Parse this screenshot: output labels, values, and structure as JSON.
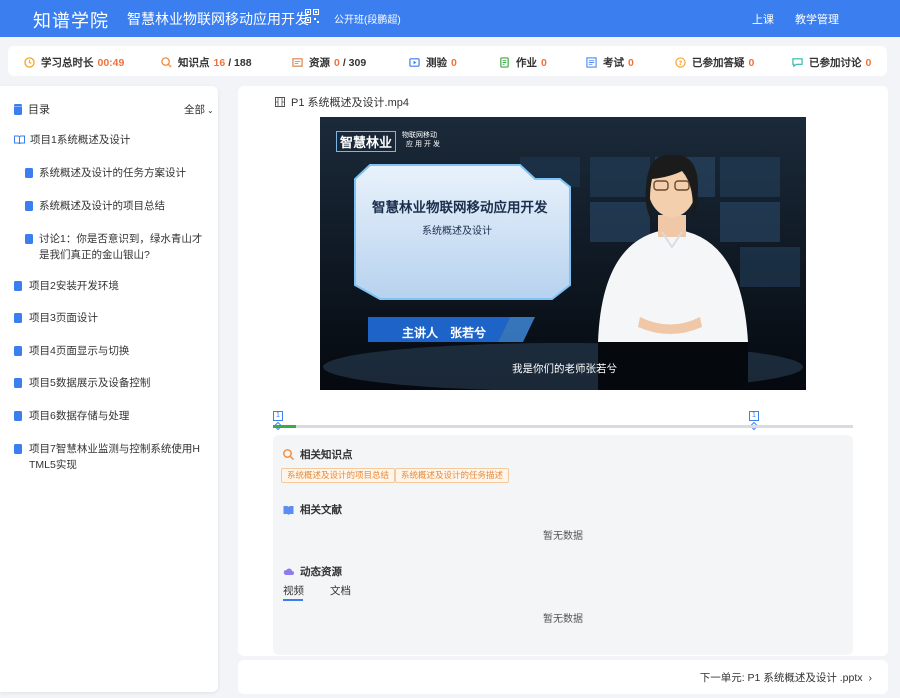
{
  "header": {
    "logo": "知谱学院",
    "course_title": "智慧林业物联网移动应用开发",
    "class_name": "公开班(段鹏超)",
    "nav": {
      "class": "上课",
      "manage": "教学管理"
    },
    "brand_color": "#3a7ef0"
  },
  "stats": [
    {
      "label": "学习总时长",
      "value": "00:49",
      "total": "",
      "icon": "clock-icon"
    },
    {
      "label": "知识点",
      "value": "16",
      "total": "/ 188",
      "icon": "knowledge-icon"
    },
    {
      "label": "资源",
      "value": "0",
      "total": "/ 309",
      "icon": "resource-icon"
    },
    {
      "label": "测验",
      "value": "0",
      "total": "",
      "icon": "quiz-icon"
    },
    {
      "label": "作业",
      "value": "0",
      "total": "",
      "icon": "homework-icon"
    },
    {
      "label": "考试",
      "value": "0",
      "total": "",
      "icon": "exam-icon"
    },
    {
      "label": "已参加答疑",
      "value": "0",
      "total": "",
      "icon": "qa-icon"
    },
    {
      "label": "已参加讨论",
      "value": "0",
      "total": "",
      "icon": "discussion-icon"
    }
  ],
  "sidebar": {
    "title": "目录",
    "filter": "全部",
    "items": [
      {
        "label": "项目1系统概述及设计",
        "level": 0
      },
      {
        "label": "系统概述及设计的任务方案设计",
        "level": 1
      },
      {
        "label": "系统概述及设计的项目总结",
        "level": 1
      },
      {
        "label": "讨论1：你是否意识到，绿水青山才是我们真正的金山银山?",
        "level": 1
      },
      {
        "label": "项目2安装开发环境",
        "level": 0
      },
      {
        "label": "项目3页面设计",
        "level": 0
      },
      {
        "label": "项目4页面显示与切换",
        "level": 0
      },
      {
        "label": "项目5数据展示及设备控制",
        "level": 0
      },
      {
        "label": "项目6数据存储与处理",
        "level": 0
      },
      {
        "label": "项目7智慧林业监测与控制系统使用HTML5实现",
        "level": 0
      }
    ]
  },
  "main": {
    "file_title": "P1 系统概述及设计.mp4",
    "video": {
      "brand": "智慧林业",
      "brand_sub1": "物联网移动",
      "brand_sub2": "应用开发",
      "headline": "智慧林业物联网移动应用开发",
      "subheadline": "系统概述及设计",
      "presenter": "主讲人　张若兮",
      "subtitle": "我是你们的老师张若兮"
    },
    "progress": 0.04,
    "markers": [
      "1",
      "1"
    ],
    "knowledge": {
      "title": "相关知识点",
      "tags": [
        "系统概述及设计的项目总结",
        "系统概述及设计的任务描述"
      ]
    },
    "literature": {
      "title": "相关文献",
      "empty": "暂无数据"
    },
    "dynamic": {
      "title": "动态资源",
      "tabs": [
        "视频",
        "文档"
      ],
      "empty": "暂无数据"
    },
    "next": "下一单元:  P1 系统概述及设计 .pptx"
  }
}
